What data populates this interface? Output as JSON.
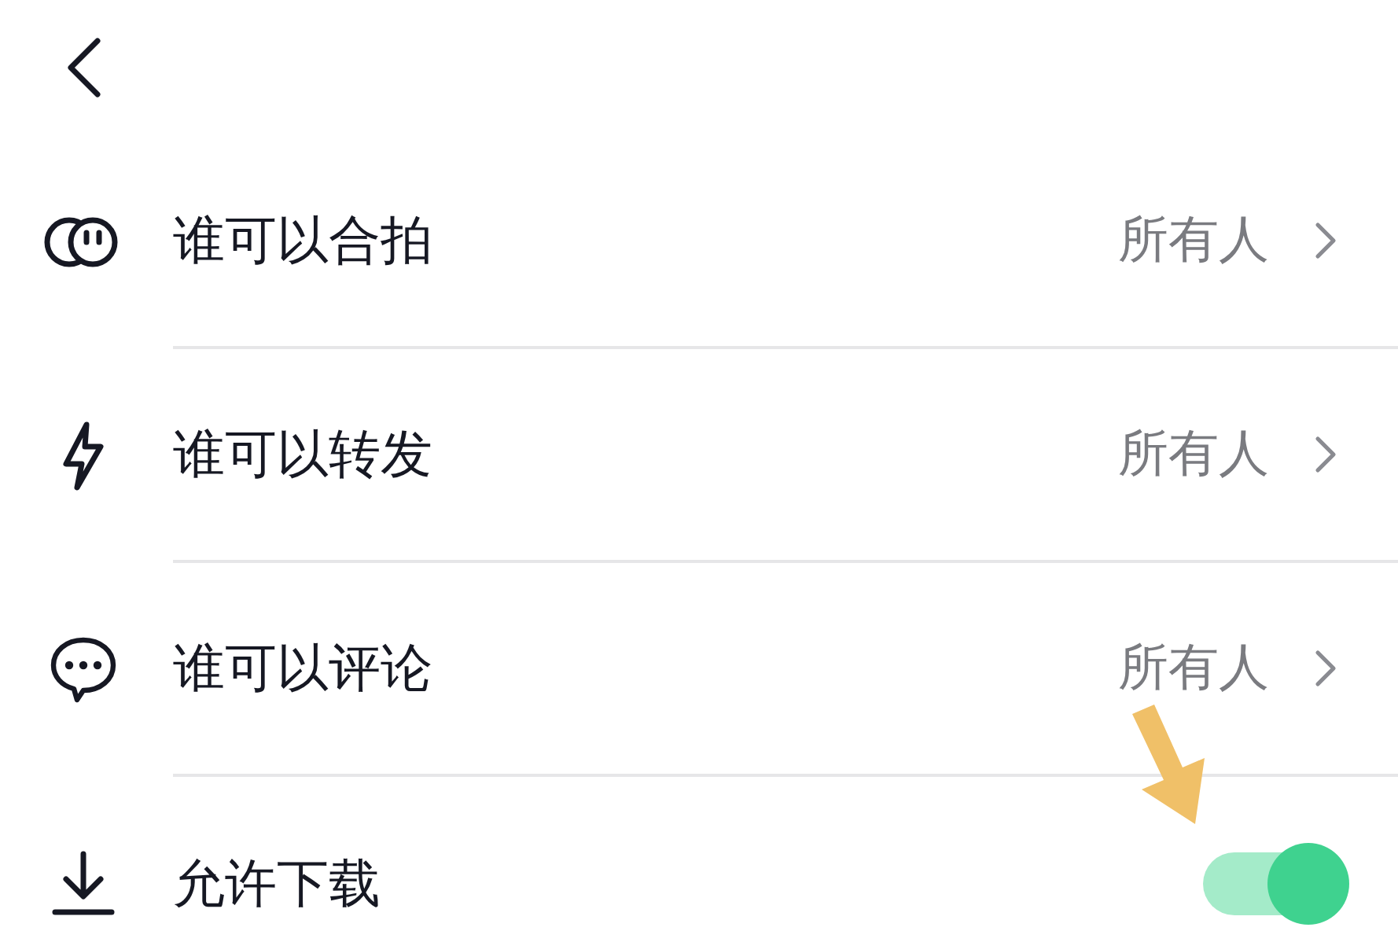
{
  "rows": [
    {
      "kind": "link",
      "label": "谁可以合拍",
      "value": "所有人"
    },
    {
      "kind": "link",
      "label": "谁可以转发",
      "value": "所有人"
    },
    {
      "kind": "link",
      "label": "谁可以评论",
      "value": "所有人"
    },
    {
      "kind": "toggle",
      "label": "允许下载",
      "on": true
    }
  ]
}
